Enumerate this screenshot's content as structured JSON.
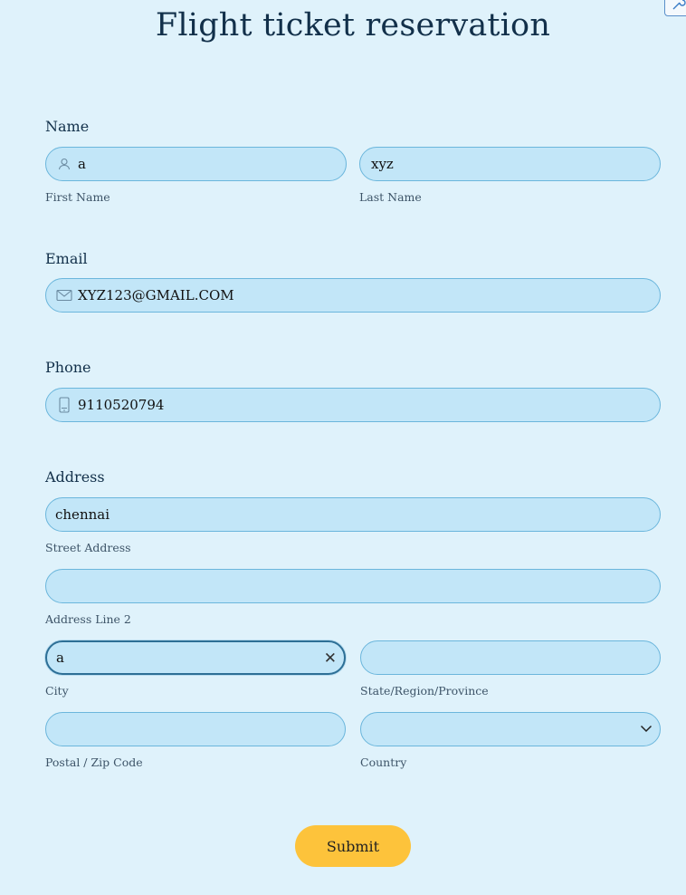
{
  "page": {
    "title": "Flight ticket reservation"
  },
  "name": {
    "label": "Name",
    "first": {
      "value": "a",
      "sublabel": "First Name"
    },
    "last": {
      "value": "xyz",
      "sublabel": "Last Name"
    }
  },
  "email": {
    "label": "Email",
    "value": "XYZ123@GMAIL.COM"
  },
  "phone": {
    "label": "Phone",
    "value": "9110520794"
  },
  "address": {
    "label": "Address",
    "street": {
      "value": "chennai",
      "sublabel": "Street Address"
    },
    "line2": {
      "value": "",
      "sublabel": "Address Line 2"
    },
    "city": {
      "value": "a",
      "sublabel": "City",
      "clear_glyph": "✕"
    },
    "state": {
      "value": "",
      "sublabel": "State/Region/Province"
    },
    "postal": {
      "value": "",
      "sublabel": "Postal / Zip Code"
    },
    "country": {
      "value": "",
      "sublabel": "Country"
    }
  },
  "submit": {
    "label": "Submit"
  },
  "colors": {
    "background": "#dff2fb",
    "field": "#c2e6f8",
    "field_border": "#6bb6dc",
    "submit": "#fdc33b",
    "title": "#12304a"
  },
  "icons": [
    "person-icon",
    "envelope-icon",
    "phone-icon",
    "chevron-down-icon",
    "wrench-icon",
    "close-icon"
  ]
}
